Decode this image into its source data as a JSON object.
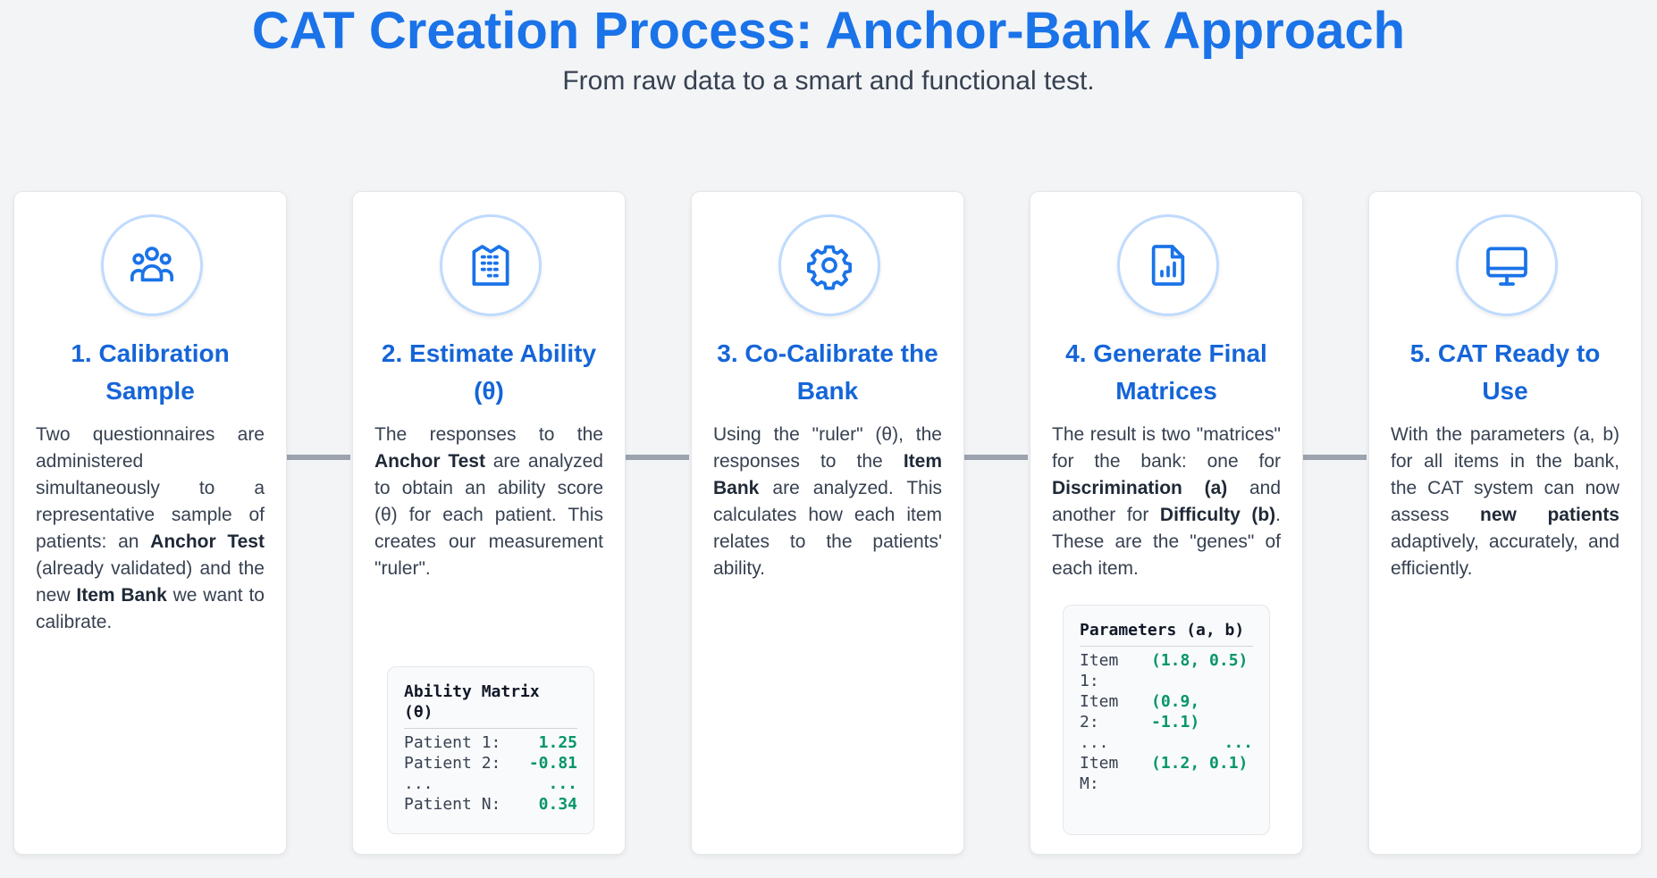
{
  "header": {
    "title": "CAT Creation Process: Anchor-Bank Approach",
    "subtitle": "From raw data to a smart and functional test."
  },
  "colors": {
    "accent": "#1a73e8",
    "card_title": "#1565d8",
    "value_green": "#059669",
    "connector": "#9ca3af"
  },
  "steps": [
    {
      "icon": "users-group-icon",
      "title": "1. Calibration Sample",
      "text": [
        {
          "t": "Two questionnaires are administered simultaneously to a representative sample of patients: an "
        },
        {
          "t": "Anchor Test",
          "b": true
        },
        {
          "t": " (already validated) and the new "
        },
        {
          "t": "Item Bank",
          "b": true
        },
        {
          "t": " we want to calibrate."
        }
      ]
    },
    {
      "icon": "building-icon",
      "title": "2. Estimate Ability (θ)",
      "text": [
        {
          "t": "The responses to the "
        },
        {
          "t": "Anchor Test",
          "b": true
        },
        {
          "t": " are analyzed to obtain an ability score (θ) for each patient. This creates our measurement \"ruler\"."
        }
      ],
      "matrix": {
        "title": "Ability Matrix (θ)",
        "rows": [
          {
            "label": "Patient 1:",
            "value": "1.25"
          },
          {
            "label": "Patient 2:",
            "value": "-0.81"
          },
          {
            "label": "...",
            "value": "..."
          },
          {
            "label": "Patient N:",
            "value": "0.34"
          }
        ]
      }
    },
    {
      "icon": "gear-icon",
      "title": "3. Co-Calibrate the Bank",
      "text": [
        {
          "t": "Using the \"ruler\" (θ), the responses to the "
        },
        {
          "t": "Item Bank",
          "b": true
        },
        {
          "t": " are analyzed. This calculates how each item relates to the patients' ability."
        }
      ]
    },
    {
      "icon": "document-chart-icon",
      "title": "4. Generate Final Matrices",
      "text": [
        {
          "t": "The result is two \"matrices\" for the bank: one for "
        },
        {
          "t": "Discrimination (a)",
          "b": true
        },
        {
          "t": " and another for "
        },
        {
          "t": "Difficulty (b)",
          "b": true
        },
        {
          "t": ". These are the \"genes\" of each item."
        }
      ],
      "matrix": {
        "title": "Parameters (a, b)",
        "rows": [
          {
            "label": "Item 1:",
            "value": "(1.8, 0.5)"
          },
          {
            "label": "Item 2:",
            "value": "(0.9, -1.1)"
          },
          {
            "label": "...",
            "value": "..."
          },
          {
            "label": "Item M:",
            "value": "(1.2, 0.1)"
          }
        ]
      }
    },
    {
      "icon": "monitor-icon",
      "title": "5. CAT Ready to Use",
      "text": [
        {
          "t": "With the parameters (a, b) for all items in the bank, the CAT system can now assess "
        },
        {
          "t": "new patients",
          "b": true
        },
        {
          "t": " adaptively, accurately, and efficiently."
        }
      ]
    }
  ]
}
